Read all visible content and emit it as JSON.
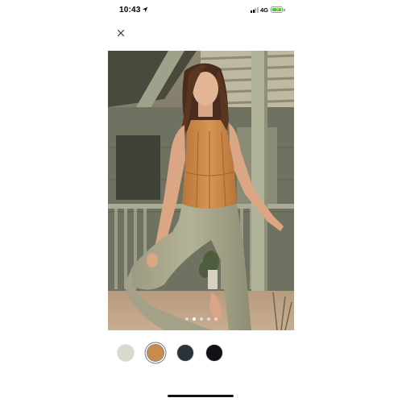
{
  "status_bar": {
    "time": "10:43",
    "network": "4G",
    "battery_level": 1.0,
    "battery_color": "#34c759"
  },
  "icons": {
    "close": "close-icon",
    "location": "location-arrow-icon"
  },
  "gallery": {
    "image_description_alt": "",
    "dots_count": 5,
    "active_dot_index": 1
  },
  "color_options": [
    {
      "name": "swatch-sage",
      "color": "#d9d8cf",
      "selected": false
    },
    {
      "name": "swatch-camel",
      "color": "#c98a4c",
      "selected": true
    },
    {
      "name": "swatch-dark-teal",
      "color": "#2a3438",
      "selected": false
    },
    {
      "name": "swatch-black",
      "color": "#101217",
      "selected": false
    }
  ]
}
